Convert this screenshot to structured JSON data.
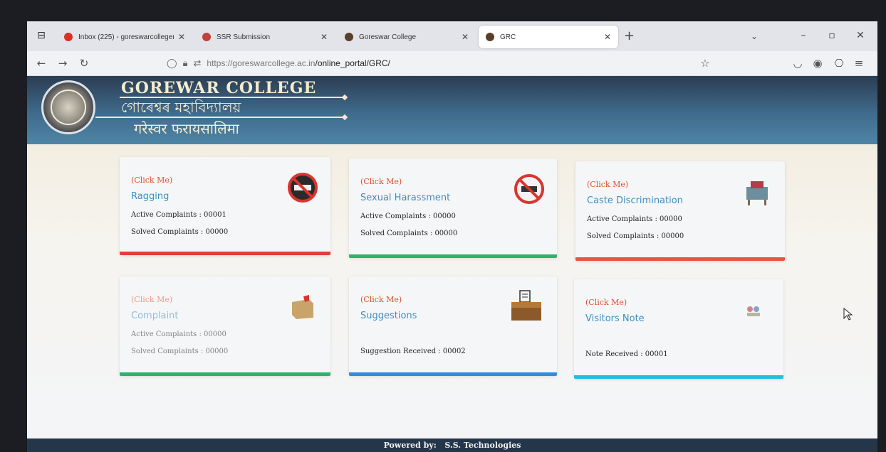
{
  "browser": {
    "tabs": [
      {
        "title": "Inbox (225) - goreswarcollegen",
        "favicon": "gmail-icon",
        "color": "#d93025"
      },
      {
        "title": "SSR Submission",
        "favicon": "ssr-icon",
        "color": "#c2413b"
      },
      {
        "title": "Goreswar College",
        "favicon": "college-icon",
        "color": "#5a3e2b"
      },
      {
        "title": "GRC",
        "favicon": "college-icon",
        "color": "#5a3e2b"
      }
    ],
    "active_tab_index": 3,
    "url_host": "https://goreswarcollege.ac.in",
    "url_path": "/online_portal/GRC/"
  },
  "header": {
    "name_en": "GOREWAR COLLEGE",
    "name_as": "গোৰেশ্বৰ মহাবিদ্যালয়",
    "name_bo": "गरेस्वर फरायसालिमा"
  },
  "cards": [
    {
      "click": "(Click Me)",
      "title": "Ragging",
      "stat1": "Active Complaints : 00001",
      "stat2": "Solved Complaints : 00000",
      "bar_color": "#e0403a",
      "icon": "no-ragging-icon"
    },
    {
      "click": "(Click Me)",
      "title": "Sexual Harassment",
      "stat1": "Active Complaints : 00000",
      "stat2": "Solved Complaints : 00000",
      "bar_color": "#2db36a",
      "icon": "no-sexual-harassment-icon"
    },
    {
      "click": "(Click Me)",
      "title": "Caste Discrimination",
      "stat1": "Active Complaints : 00000",
      "stat2": "Solved Complaints : 00000",
      "bar_color": "#e8553a",
      "icon": "caste-discrimination-icon"
    },
    {
      "click": "(Click Me)",
      "title": "Complaint",
      "stat1": "Active Complaints : 00000",
      "stat2": "Solved Complaints : 00000",
      "bar_color": "#2db36a",
      "icon": "complaint-box-icon"
    },
    {
      "click": "(Click Me)",
      "title": "Suggestions",
      "stat1": "",
      "stat2": "Suggestion Received : 00002",
      "bar_color": "#2f8ce0",
      "icon": "suggestion-box-icon"
    },
    {
      "click": "(Click Me)",
      "title": "Visitors Note",
      "stat1": "",
      "stat2": "Note Received : 00001",
      "bar_color": "#1fc0dc",
      "icon": "visitors-note-icon"
    }
  ],
  "footer": {
    "label": "Powered by:",
    "company": "S.S. Technologies"
  },
  "colors": {
    "click_me": "#e0502e",
    "title": "#3f8fbf",
    "banner": "#3f6b8c"
  }
}
